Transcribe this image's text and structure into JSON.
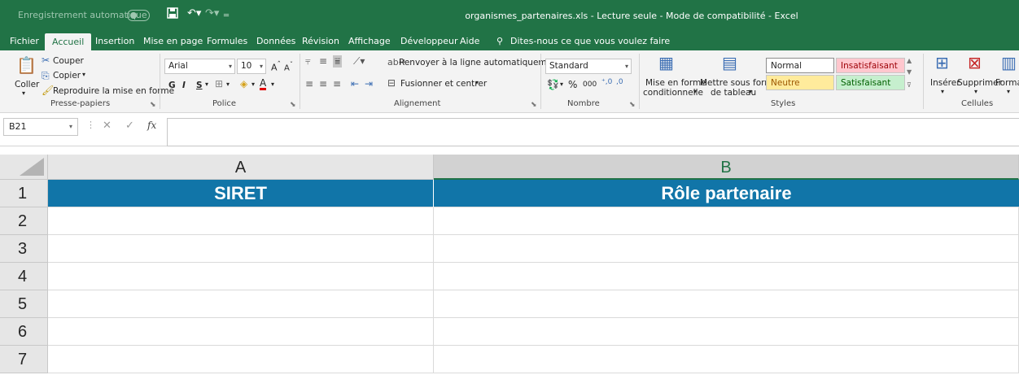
{
  "titlebar": {
    "autosave_label": "Enregistrement automatique",
    "autosave_state": "off",
    "title": "organismes_partenaires.xls  -  Lecture seule  -  Mode de compatibilité  -  Excel",
    "accent_color": "#217346"
  },
  "tabs": [
    {
      "label": "Fichier"
    },
    {
      "label": "Accueil",
      "active": true
    },
    {
      "label": "Insertion"
    },
    {
      "label": "Mise en page"
    },
    {
      "label": "Formules"
    },
    {
      "label": "Données"
    },
    {
      "label": "Révision"
    },
    {
      "label": "Affichage"
    },
    {
      "label": "Développeur"
    },
    {
      "label": "Aide"
    }
  ],
  "tell_me": {
    "placeholder": "Dites-nous ce que vous voulez faire",
    "icon": "lightbulb-icon"
  },
  "ribbon": {
    "clipboard": {
      "paste": "Coller",
      "cut": "Couper",
      "copy": "Copier",
      "format_painter": "Reproduire la mise en forme",
      "label": "Presse-papiers"
    },
    "font": {
      "font_name": "Arial",
      "font_size": "10",
      "bold": "G",
      "italic": "I",
      "underline": "S",
      "label": "Police"
    },
    "alignment": {
      "wrap_text": "Renvoyer à la ligne automatiquement",
      "merge_center": "Fusionner et centrer",
      "label": "Alignement"
    },
    "number": {
      "format": "Standard",
      "percent": "%",
      "thousands": "000",
      "label": "Nombre"
    },
    "styles": {
      "conditional_1": "Mise en forme",
      "conditional_2": "conditionnelle",
      "table_1": "Mettre sous forme",
      "table_2": "de tableau",
      "normal": "Normal",
      "bad": "Insatisfaisant",
      "neutral": "Neutre",
      "good": "Satisfaisant",
      "label": "Styles"
    },
    "cells": {
      "insert": "Insérer",
      "delete": "Supprimer",
      "format": "Format",
      "label": "Cellules"
    }
  },
  "formula_bar": {
    "name_box": "B21",
    "fx": "fx",
    "formula": ""
  },
  "sheet": {
    "columns": [
      "A",
      "B"
    ],
    "selected_column": "B",
    "rows": [
      "1",
      "2",
      "3",
      "4",
      "5",
      "6",
      "7"
    ],
    "header_row": [
      "SIRET",
      "Rôle partenaire"
    ],
    "header_fill": "#1175a8"
  }
}
